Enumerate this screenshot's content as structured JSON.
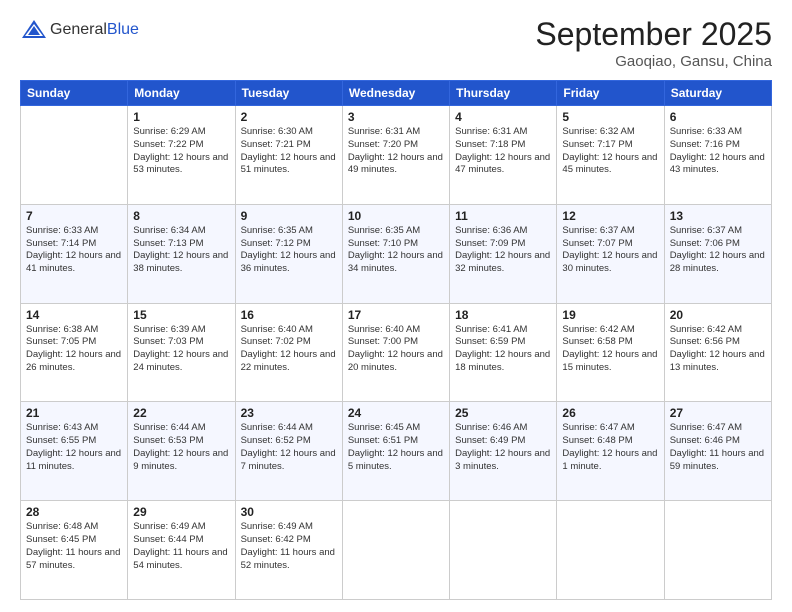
{
  "header": {
    "logo_general": "General",
    "logo_blue": "Blue",
    "month_title": "September 2025",
    "location": "Gaoqiao, Gansu, China"
  },
  "days_of_week": [
    "Sunday",
    "Monday",
    "Tuesday",
    "Wednesday",
    "Thursday",
    "Friday",
    "Saturday"
  ],
  "weeks": [
    [
      {
        "day": "",
        "sunrise": "",
        "sunset": "",
        "daylight": ""
      },
      {
        "day": "1",
        "sunrise": "Sunrise: 6:29 AM",
        "sunset": "Sunset: 7:22 PM",
        "daylight": "Daylight: 12 hours and 53 minutes."
      },
      {
        "day": "2",
        "sunrise": "Sunrise: 6:30 AM",
        "sunset": "Sunset: 7:21 PM",
        "daylight": "Daylight: 12 hours and 51 minutes."
      },
      {
        "day": "3",
        "sunrise": "Sunrise: 6:31 AM",
        "sunset": "Sunset: 7:20 PM",
        "daylight": "Daylight: 12 hours and 49 minutes."
      },
      {
        "day": "4",
        "sunrise": "Sunrise: 6:31 AM",
        "sunset": "Sunset: 7:18 PM",
        "daylight": "Daylight: 12 hours and 47 minutes."
      },
      {
        "day": "5",
        "sunrise": "Sunrise: 6:32 AM",
        "sunset": "Sunset: 7:17 PM",
        "daylight": "Daylight: 12 hours and 45 minutes."
      },
      {
        "day": "6",
        "sunrise": "Sunrise: 6:33 AM",
        "sunset": "Sunset: 7:16 PM",
        "daylight": "Daylight: 12 hours and 43 minutes."
      }
    ],
    [
      {
        "day": "7",
        "sunrise": "Sunrise: 6:33 AM",
        "sunset": "Sunset: 7:14 PM",
        "daylight": "Daylight: 12 hours and 41 minutes."
      },
      {
        "day": "8",
        "sunrise": "Sunrise: 6:34 AM",
        "sunset": "Sunset: 7:13 PM",
        "daylight": "Daylight: 12 hours and 38 minutes."
      },
      {
        "day": "9",
        "sunrise": "Sunrise: 6:35 AM",
        "sunset": "Sunset: 7:12 PM",
        "daylight": "Daylight: 12 hours and 36 minutes."
      },
      {
        "day": "10",
        "sunrise": "Sunrise: 6:35 AM",
        "sunset": "Sunset: 7:10 PM",
        "daylight": "Daylight: 12 hours and 34 minutes."
      },
      {
        "day": "11",
        "sunrise": "Sunrise: 6:36 AM",
        "sunset": "Sunset: 7:09 PM",
        "daylight": "Daylight: 12 hours and 32 minutes."
      },
      {
        "day": "12",
        "sunrise": "Sunrise: 6:37 AM",
        "sunset": "Sunset: 7:07 PM",
        "daylight": "Daylight: 12 hours and 30 minutes."
      },
      {
        "day": "13",
        "sunrise": "Sunrise: 6:37 AM",
        "sunset": "Sunset: 7:06 PM",
        "daylight": "Daylight: 12 hours and 28 minutes."
      }
    ],
    [
      {
        "day": "14",
        "sunrise": "Sunrise: 6:38 AM",
        "sunset": "Sunset: 7:05 PM",
        "daylight": "Daylight: 12 hours and 26 minutes."
      },
      {
        "day": "15",
        "sunrise": "Sunrise: 6:39 AM",
        "sunset": "Sunset: 7:03 PM",
        "daylight": "Daylight: 12 hours and 24 minutes."
      },
      {
        "day": "16",
        "sunrise": "Sunrise: 6:40 AM",
        "sunset": "Sunset: 7:02 PM",
        "daylight": "Daylight: 12 hours and 22 minutes."
      },
      {
        "day": "17",
        "sunrise": "Sunrise: 6:40 AM",
        "sunset": "Sunset: 7:00 PM",
        "daylight": "Daylight: 12 hours and 20 minutes."
      },
      {
        "day": "18",
        "sunrise": "Sunrise: 6:41 AM",
        "sunset": "Sunset: 6:59 PM",
        "daylight": "Daylight: 12 hours and 18 minutes."
      },
      {
        "day": "19",
        "sunrise": "Sunrise: 6:42 AM",
        "sunset": "Sunset: 6:58 PM",
        "daylight": "Daylight: 12 hours and 15 minutes."
      },
      {
        "day": "20",
        "sunrise": "Sunrise: 6:42 AM",
        "sunset": "Sunset: 6:56 PM",
        "daylight": "Daylight: 12 hours and 13 minutes."
      }
    ],
    [
      {
        "day": "21",
        "sunrise": "Sunrise: 6:43 AM",
        "sunset": "Sunset: 6:55 PM",
        "daylight": "Daylight: 12 hours and 11 minutes."
      },
      {
        "day": "22",
        "sunrise": "Sunrise: 6:44 AM",
        "sunset": "Sunset: 6:53 PM",
        "daylight": "Daylight: 12 hours and 9 minutes."
      },
      {
        "day": "23",
        "sunrise": "Sunrise: 6:44 AM",
        "sunset": "Sunset: 6:52 PM",
        "daylight": "Daylight: 12 hours and 7 minutes."
      },
      {
        "day": "24",
        "sunrise": "Sunrise: 6:45 AM",
        "sunset": "Sunset: 6:51 PM",
        "daylight": "Daylight: 12 hours and 5 minutes."
      },
      {
        "day": "25",
        "sunrise": "Sunrise: 6:46 AM",
        "sunset": "Sunset: 6:49 PM",
        "daylight": "Daylight: 12 hours and 3 minutes."
      },
      {
        "day": "26",
        "sunrise": "Sunrise: 6:47 AM",
        "sunset": "Sunset: 6:48 PM",
        "daylight": "Daylight: 12 hours and 1 minute."
      },
      {
        "day": "27",
        "sunrise": "Sunrise: 6:47 AM",
        "sunset": "Sunset: 6:46 PM",
        "daylight": "Daylight: 11 hours and 59 minutes."
      }
    ],
    [
      {
        "day": "28",
        "sunrise": "Sunrise: 6:48 AM",
        "sunset": "Sunset: 6:45 PM",
        "daylight": "Daylight: 11 hours and 57 minutes."
      },
      {
        "day": "29",
        "sunrise": "Sunrise: 6:49 AM",
        "sunset": "Sunset: 6:44 PM",
        "daylight": "Daylight: 11 hours and 54 minutes."
      },
      {
        "day": "30",
        "sunrise": "Sunrise: 6:49 AM",
        "sunset": "Sunset: 6:42 PM",
        "daylight": "Daylight: 11 hours and 52 minutes."
      },
      {
        "day": "",
        "sunrise": "",
        "sunset": "",
        "daylight": ""
      },
      {
        "day": "",
        "sunrise": "",
        "sunset": "",
        "daylight": ""
      },
      {
        "day": "",
        "sunrise": "",
        "sunset": "",
        "daylight": ""
      },
      {
        "day": "",
        "sunrise": "",
        "sunset": "",
        "daylight": ""
      }
    ]
  ]
}
